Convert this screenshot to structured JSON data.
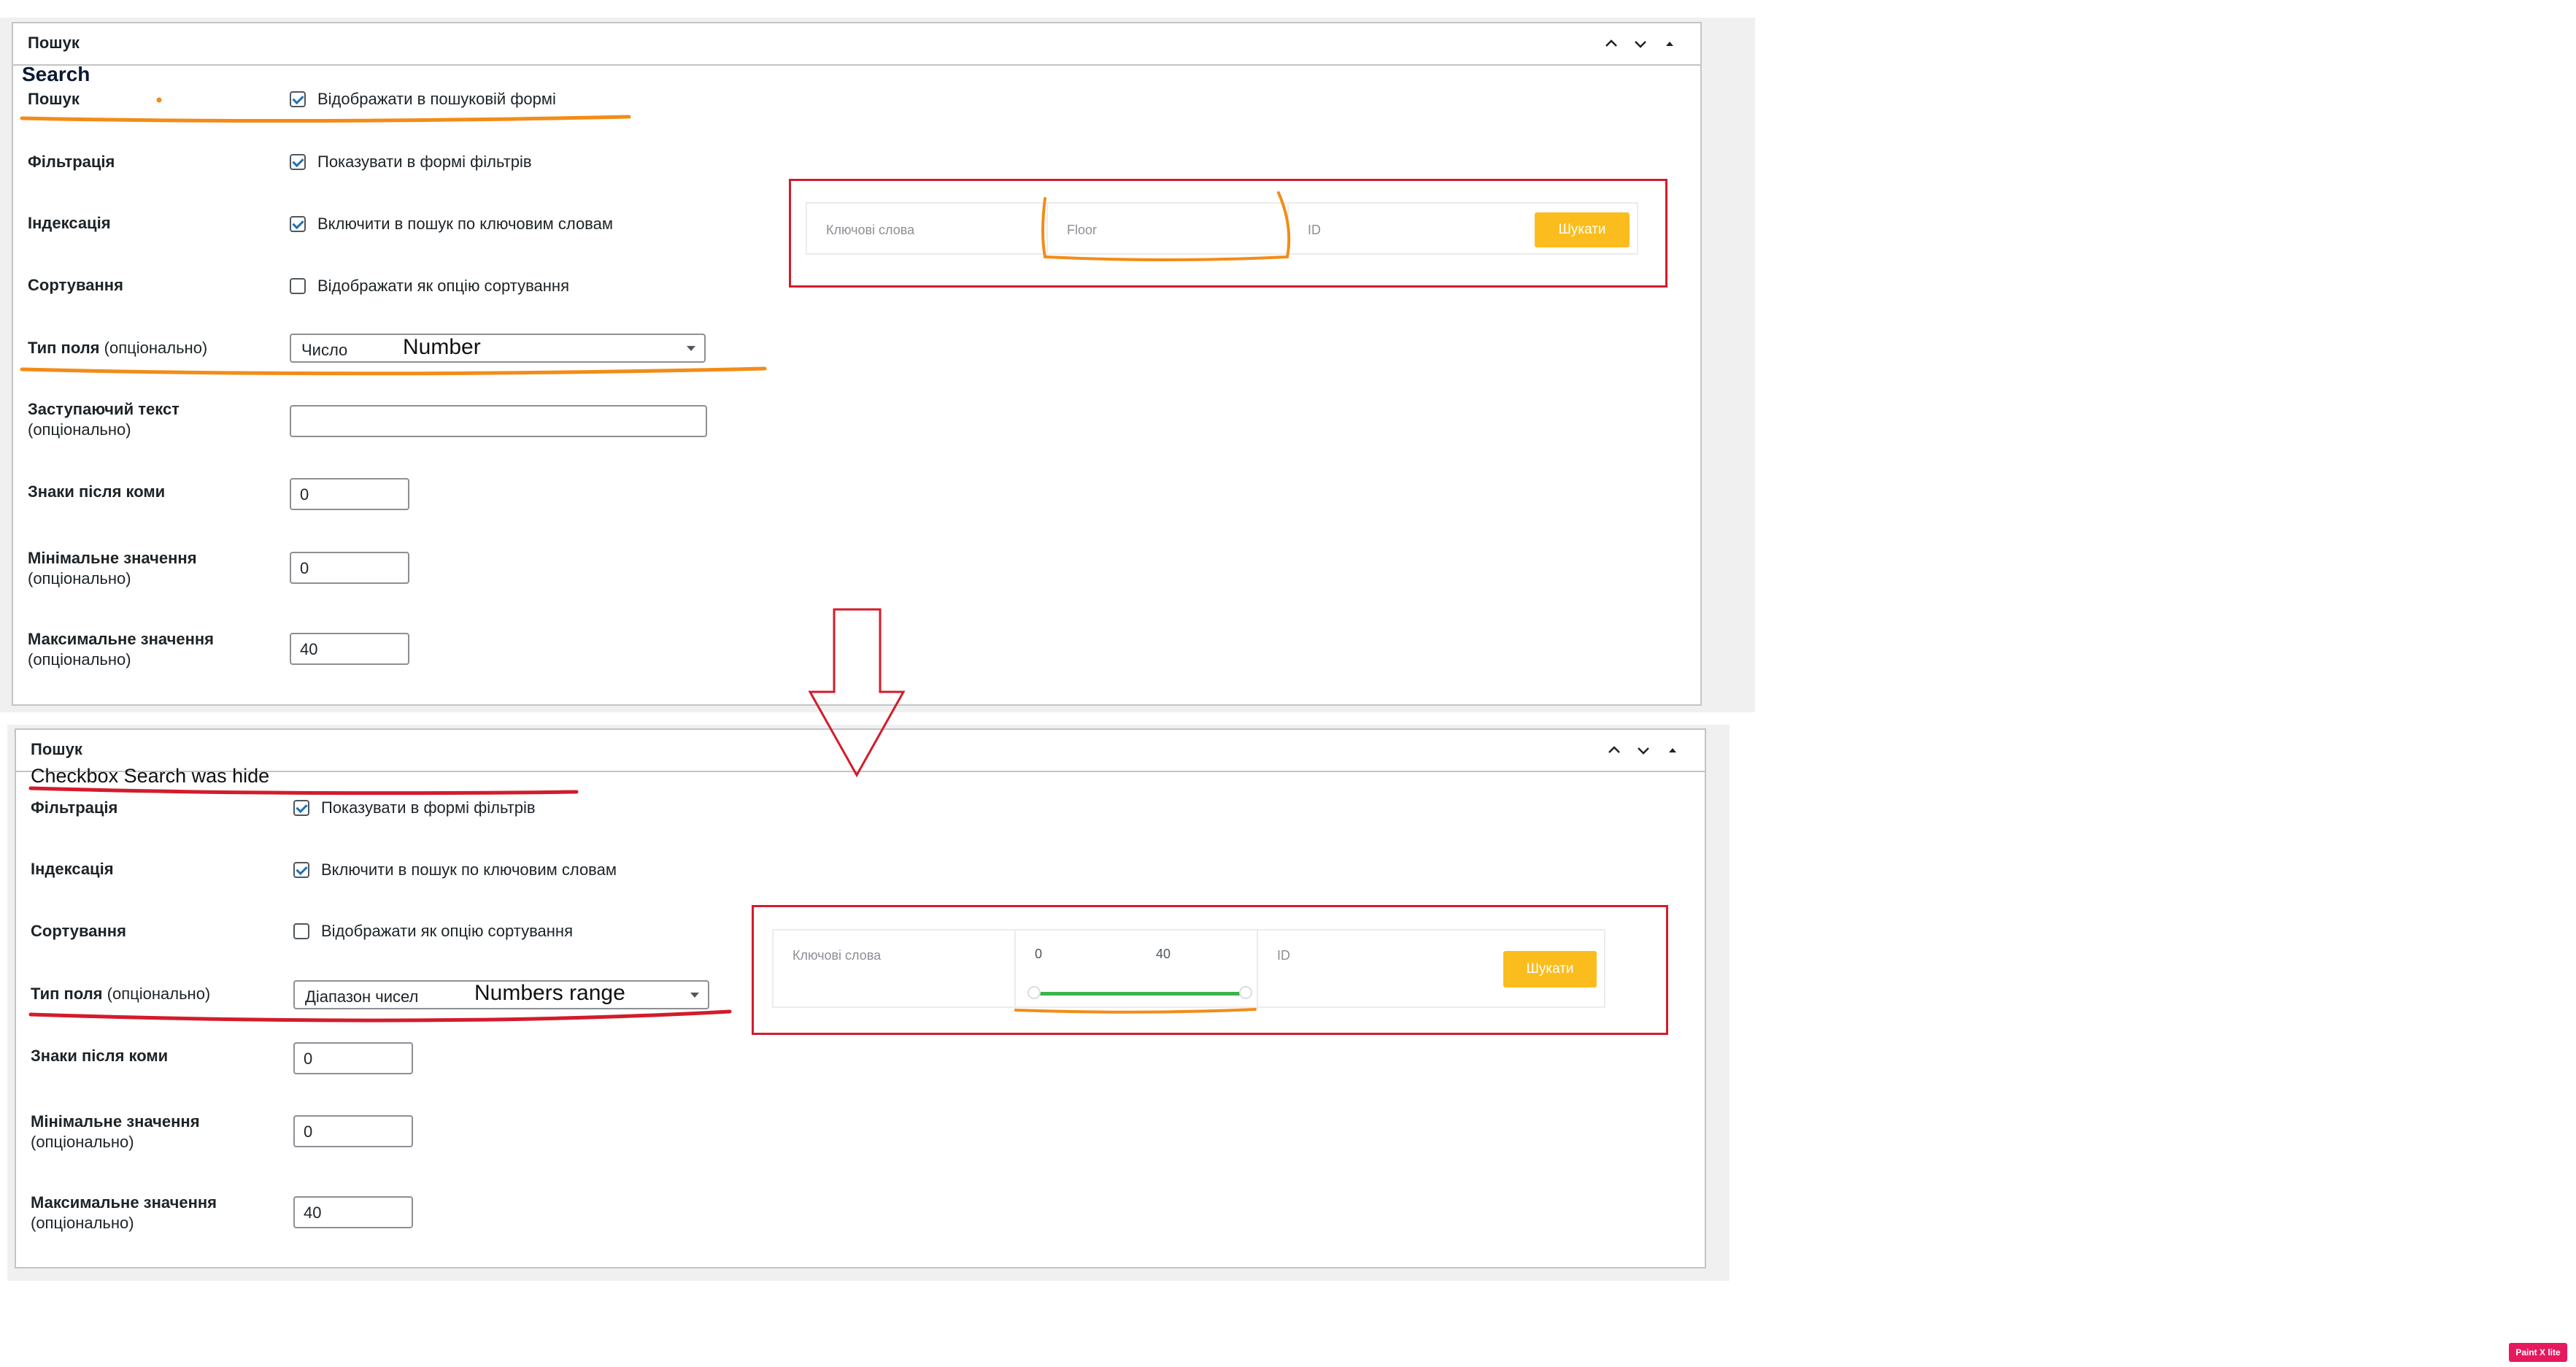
{
  "top_panel": {
    "title": "Пошук",
    "annotation_title": "Search",
    "fields": {
      "search_label": "Пошук",
      "search_checkbox_label": "Відображати в пошуковій формі",
      "filter_label": "Фільтрація",
      "filter_checkbox_label": "Показувати в формі фільтрів",
      "index_label": "Індексація",
      "index_checkbox_label": "Включити в пошук по ключовим словам",
      "sort_label": "Сортування",
      "sort_checkbox_label": "Відображати як опцію сортування",
      "type_label": "Тип поля",
      "optional": "(опціонально)",
      "type_value": "Число",
      "type_annotation": "Number",
      "placeholder_label": "Заступаючий текст",
      "placeholder_value": "",
      "decimals_label": "Знаки після коми",
      "decimals_value": "0",
      "min_label": "Мінімальне значення",
      "min_value": "0",
      "max_label": "Максимальне значення",
      "max_value": "40"
    },
    "preview": {
      "keywords": "Ключові слова",
      "floor": "Floor",
      "id": "ID",
      "button": "Шукати"
    }
  },
  "bottom_panel": {
    "title": "Пошук",
    "annotation_note": "Checkbox Search was hide",
    "fields": {
      "filter_label": "Фільтрація",
      "filter_checkbox_label": "Показувати в формі фільтрів",
      "index_label": "Індексація",
      "index_checkbox_label": "Включити в пошук по ключовим словам",
      "sort_label": "Сортування",
      "sort_checkbox_label": "Відображати як опцію сортування",
      "type_label": "Тип поля",
      "optional": "(опціонально)",
      "type_value": "Діапазон чисел",
      "type_annotation": "Numbers range",
      "decimals_label": "Знаки після коми",
      "decimals_value": "0",
      "min_label": "Мінімальне значення",
      "min_value": "0",
      "max_label": "Максимальне значення",
      "max_value": "40"
    },
    "preview": {
      "keywords": "Ключові слова",
      "range_min": "0",
      "range_max": "40",
      "id": "ID",
      "button": "Шукати"
    }
  },
  "badge": "Paint X lite",
  "colors": {
    "orange_annotation": "#f28c18",
    "red_annotation": "#d21c2c",
    "search_button": "#fbbd1e",
    "slider": "#3cb34a",
    "checkbox": "#2271b1"
  }
}
